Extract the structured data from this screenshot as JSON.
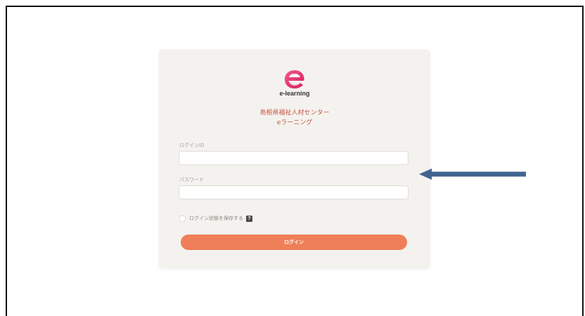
{
  "logo": {
    "text": "e-learning",
    "icon": "e-learning-logo-icon",
    "color": "#e8336f"
  },
  "org": {
    "name": "島根県福祉人材センター",
    "subtitle": "eラーニング"
  },
  "form": {
    "login_id_label": "ログインID",
    "login_id_value": "",
    "password_label": "パスワード",
    "password_value": "",
    "remember_label": "ログイン状態を保存する",
    "remember_checked": false,
    "help_icon": "question-icon",
    "login_button": "ログイン"
  },
  "annotation": {
    "arrow_icon": "left-arrow-icon",
    "arrow_color": "#41648f"
  },
  "colors": {
    "card_bg": "#f4f2ef",
    "button": "#ef7f58",
    "org_text": "#c65a45"
  }
}
